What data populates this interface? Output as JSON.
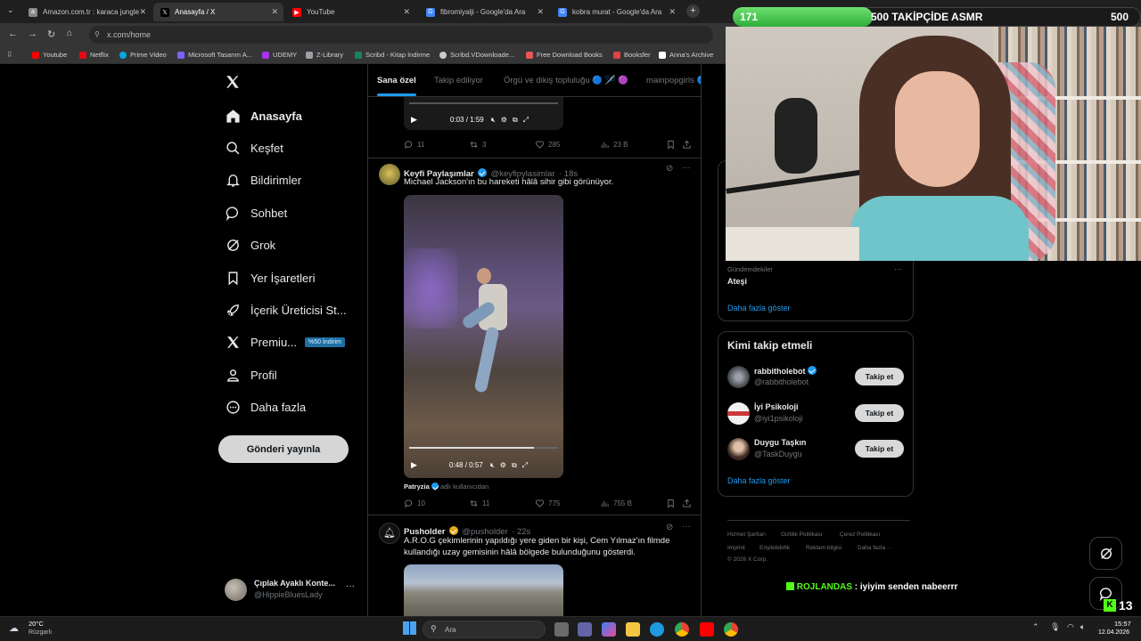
{
  "browser": {
    "tabs": [
      {
        "label": "Amazon.com.tr : karaca jungle",
        "color": "#8a8a8a",
        "glyph": "a"
      },
      {
        "label": "Anasayfa / X",
        "color": "#000000",
        "glyph": "𝕏"
      },
      {
        "label": "YouTube",
        "color": "#ff0000",
        "glyph": "▶"
      },
      {
        "label": "fibromiyalji - Google'da Ara",
        "color": "#4285f4",
        "glyph": "G"
      },
      {
        "label": "kobra murat - Google'da Ara",
        "color": "#4285f4",
        "glyph": "G"
      }
    ],
    "url": "x.com/home",
    "bookmarks": [
      {
        "label": "Youtube",
        "color": "#ff0000"
      },
      {
        "label": "Netflix",
        "color": "#e50914"
      },
      {
        "label": "Prime Video",
        "color": "#00a8e1"
      },
      {
        "label": "Microsoft Tasarım A...",
        "color": "#7b61ff"
      },
      {
        "label": "UDEMY",
        "color": "#a435f0"
      },
      {
        "label": "Z-Library",
        "color": "#9aa0a6"
      },
      {
        "label": "Scribd - Kitap İndirme",
        "color": "#1a7f64"
      },
      {
        "label": "Scribd.VDownloade...",
        "color": "#cccccc"
      },
      {
        "label": "Free Download Books",
        "color": "#e8555a"
      },
      {
        "label": "Booksfer",
        "color": "#d44"
      },
      {
        "label": "Anna's Archive",
        "color": "#ffffff"
      }
    ]
  },
  "nav": {
    "items": [
      {
        "label": "Anasayfa",
        "icon": "home-icon"
      },
      {
        "label": "Keşfet",
        "icon": "search-icon"
      },
      {
        "label": "Bildirimler",
        "icon": "bell-icon"
      },
      {
        "label": "Sohbet",
        "icon": "chat-icon"
      },
      {
        "label": "Grok",
        "icon": "grok-icon"
      },
      {
        "label": "Yer İşaretleri",
        "icon": "bookmark-icon"
      },
      {
        "label": "İçerik Üreticisi St...",
        "icon": "rocket-icon"
      },
      {
        "label": "Premiu...",
        "icon": "x-logo-icon"
      },
      {
        "label": "Profil",
        "icon": "person-icon"
      },
      {
        "label": "Daha fazla",
        "icon": "more-circle-icon"
      }
    ],
    "premium_badge": "%50 İndirim",
    "post_button": "Gönderi yayınla",
    "account": {
      "name": "Çıplak Ayaklı Konte...",
      "handle": "@HippieBluesLady"
    }
  },
  "timeline": {
    "tabs": [
      "Sana özel",
      "Takip ediliyor",
      "Örgü ve dikiş topluluğu 🔵 🪡 🟣",
      "mainpopgirls 🔵"
    ],
    "top_video": {
      "time": "0:03 / 1:59"
    },
    "top_stats": {
      "replies": "11",
      "reposts": "3",
      "likes": "285",
      "views": "23 B"
    },
    "tweet1": {
      "name": "Keyfi Paylaşımlar",
      "handle": "@keyfipylasimlar",
      "time": "· 18s",
      "text": "Michael Jackson'ın bu hareketi hâlâ sihir gibi görünüyor.",
      "video_time": "0:48 / 0:57",
      "credit_user": "Patryzia",
      "credit_suffix": "adlı kullanıcıdan",
      "replies": "10",
      "reposts": "11",
      "likes": "775",
      "views": "755 B"
    },
    "tweet2": {
      "name": "Pusholder",
      "handle": "@pusholder",
      "time": "· 22s",
      "text": "A.R.O.G çekimlerinin yapıldığı yere giden bir kişi, Cem Yılmaz'ın filmde kullandığı uzay gemisinin hâlâ bölgede bulunduğunu gösterdi."
    }
  },
  "sidebar": {
    "trend_label": "Gündemdekiler",
    "trend_title": "Ateşi",
    "trend_more": "Daha fazla göster",
    "wtf_title": "Kimi takip etmeli",
    "wtf": [
      {
        "name": "rabbitholebot",
        "handle": "@rabbitholebot",
        "button": "Takip et",
        "avatar_color": "#6a6f75"
      },
      {
        "name": "İyi Psikoloji",
        "handle": "@iyi1psikoloji",
        "button": "Takip et",
        "avatar_color": "#c9393a"
      },
      {
        "name": "Duygu Taşkın",
        "handle": "@TaskDuygu",
        "button": "Takip et",
        "avatar_color": "#8a6a58"
      }
    ],
    "wtf_more": "Daha fazla göster",
    "footer": [
      "Hizmet Şartları",
      "Gizlilik Politikası",
      "Çerez Politikası",
      "Imprint",
      "Erişilebilirlik",
      "Reklam bilgisi",
      "Daha fazla ···",
      "© 2026 X Corp."
    ]
  },
  "overlay": {
    "goal_current": "171",
    "goal_text": "500 TAKİPÇİDE ASMR",
    "goal_target": "500",
    "goal_progress": 0.342,
    "chat_user": "ROJLANDAS",
    "chat_message": ": iyiyim senden nabeerrr",
    "viewer_count": "13"
  },
  "taskbar": {
    "weather_temp": "20°C",
    "weather_desc": "Rüzgarlı",
    "search_placeholder": "Ara",
    "time": "15:57",
    "date": "12.04.2026"
  }
}
